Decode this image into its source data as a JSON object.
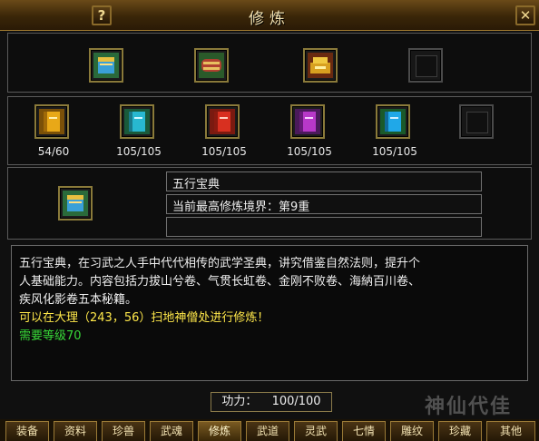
{
  "window": {
    "title": "修炼",
    "help_label": "?",
    "close_label": "✕"
  },
  "top_slots": [
    {
      "name": "five-elements-book",
      "color": "#3aa0d8"
    },
    {
      "name": "scroll-bundle",
      "color": "#b04030"
    },
    {
      "name": "golden-treasure",
      "color": "#d8a020"
    },
    {
      "name": "empty",
      "color": ""
    }
  ],
  "books": [
    {
      "color": "#e8a818",
      "count": "54/60"
    },
    {
      "color": "#28b8d0",
      "count": "105/105"
    },
    {
      "color": "#d83020",
      "count": "105/105"
    },
    {
      "color": "#b838c8",
      "count": "105/105"
    },
    {
      "color": "#20a8e8",
      "count": "105/105"
    },
    {
      "color": "",
      "count": ""
    }
  ],
  "selected": {
    "name": "五行宝典",
    "realm": "当前最高修炼境界：第9重",
    "extra": ""
  },
  "description": {
    "line1": "五行宝典，在习武之人手中代代相传的武学圣典，讲究借鉴自然法则，提升个",
    "line2": "人基础能力。内容包括力拔山兮卷、气贯长虹卷、金刚不败卷、海納百川卷、",
    "line3": "疾风化影卷五本秘籍。",
    "location": "可以在大理（243，56）扫地神僧处进行修炼！",
    "requirement": "需要等级70"
  },
  "power": {
    "label": "功力：",
    "value": "100/100"
  },
  "tabs": [
    "装备",
    "资料",
    "珍兽",
    "武魂",
    "修炼",
    "武道",
    "灵武",
    "七情",
    "雕纹",
    "珍藏",
    "其他"
  ],
  "active_tab": "修炼",
  "watermark": "神仙代佳"
}
